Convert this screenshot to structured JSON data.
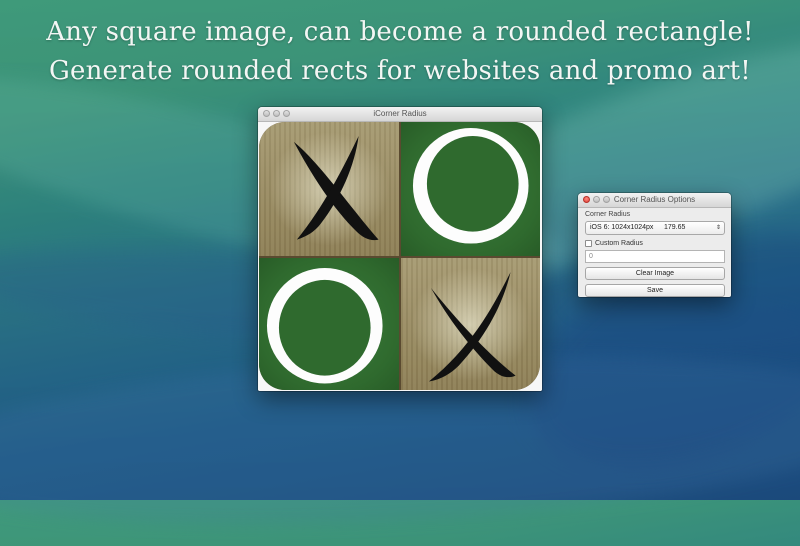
{
  "promo": {
    "line1": "Any square image, can become a rounded rectangle!",
    "line2": "Generate rounded rects for websites and promo art!"
  },
  "main_window": {
    "title": "iCorner Radius",
    "tiles": [
      "X",
      "O",
      "O",
      "X"
    ]
  },
  "options_window": {
    "title": "Corner Radius Options",
    "corner_radius_label": "Corner Radius",
    "preset": {
      "selected_label": "iOS 6: 1024x1024px",
      "selected_value": "179.65"
    },
    "custom_radius": {
      "label": "Custom Radius",
      "checked": false,
      "value": "0"
    },
    "clear_button_label": "Clear Image",
    "save_button_label": "Save"
  },
  "colors": {
    "sky_top": "#3f9a7a",
    "sea_bottom": "#1d4f86",
    "felt_green": "#2f6a2e",
    "wood": "#a79b72"
  }
}
